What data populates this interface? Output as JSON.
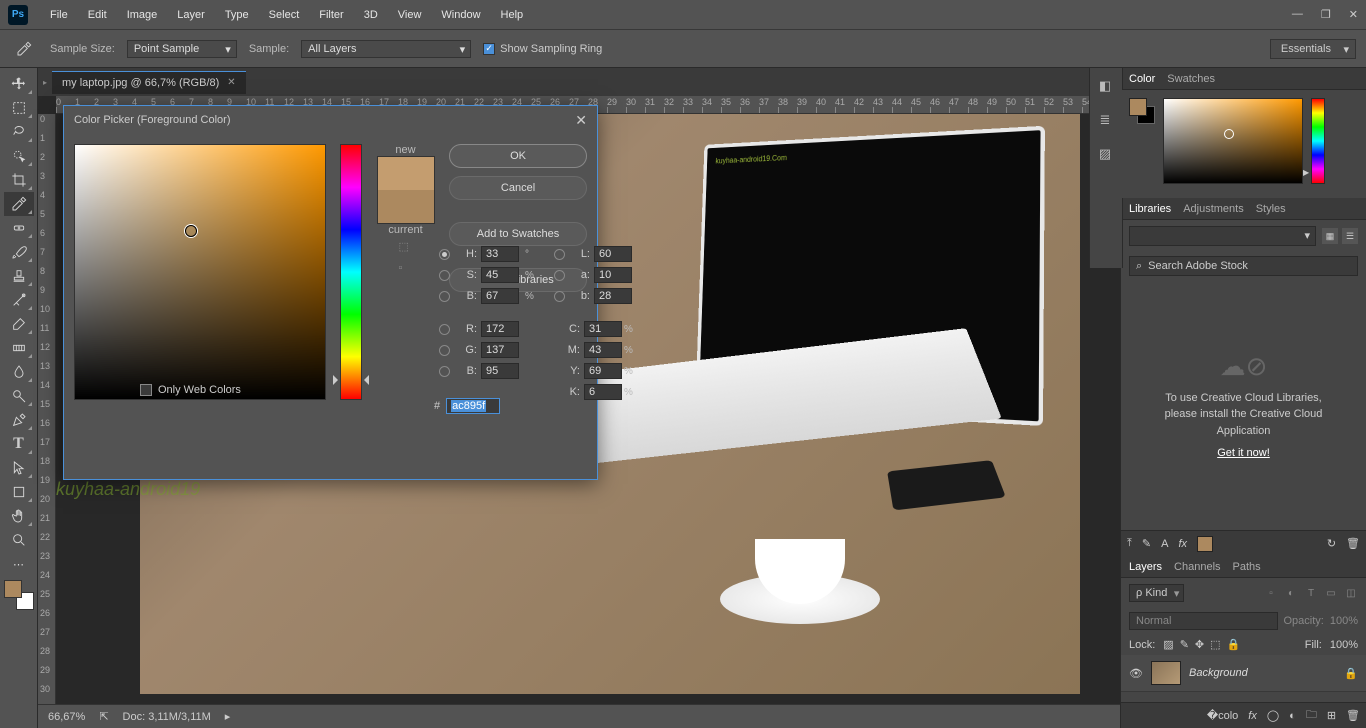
{
  "menu": {
    "file": "File",
    "edit": "Edit",
    "image": "Image",
    "layer": "Layer",
    "type": "Type",
    "select": "Select",
    "filter": "Filter",
    "three_d": "3D",
    "view": "View",
    "window": "Window",
    "help": "Help"
  },
  "options": {
    "sample_size_label": "Sample Size:",
    "sample_size_value": "Point Sample",
    "sample_label": "Sample:",
    "sample_value": "All Layers",
    "show_ring": "Show Sampling Ring",
    "workspace": "Essentials"
  },
  "doc": {
    "tab": "my laptop.jpg @ 66,7% (RGB/8)"
  },
  "watermark": "kuyhaa-android19",
  "status": {
    "zoom": "66,67%",
    "doc": "Doc: 3,11M/3,11M"
  },
  "picker": {
    "title": "Color Picker (Foreground Color)",
    "new": "new",
    "current": "current",
    "ok": "OK",
    "cancel": "Cancel",
    "add": "Add to Swatches",
    "libs": "Color Libraries",
    "only_web": "Only Web Colors",
    "h_lbl": "H:",
    "h": "33",
    "deg": "°",
    "s_lbl": "S:",
    "s": "45",
    "b_lbl": "B:",
    "b": "67",
    "r_lbl": "R:",
    "r": "172",
    "g_lbl": "G:",
    "g": "137",
    "bb_lbl": "B:",
    "bb": "95",
    "l_lbl": "L:",
    "l": "60",
    "a_lbl": "a:",
    "a": "10",
    "lab_b_lbl": "b:",
    "lab_b": "28",
    "c_lbl": "C:",
    "c": "31",
    "m_lbl": "M:",
    "m": "43",
    "y_lbl": "Y:",
    "y": "69",
    "k_lbl": "K:",
    "k": "6",
    "pct": "%",
    "hash": "#",
    "hex": "ac895f"
  },
  "panels": {
    "color": "Color",
    "swatches": "Swatches",
    "libraries": "Libraries",
    "adjustments": "Adjustments",
    "styles": "Styles",
    "search_ph": "Search Adobe Stock",
    "lib_msg1": "To use Creative Cloud Libraries,",
    "lib_msg2": "please install the Creative Cloud",
    "lib_msg3": "Application",
    "getit": "Get it now!",
    "layers": "Layers",
    "channels": "Channels",
    "paths": "Paths",
    "kind": "Kind",
    "normal": "Normal",
    "opacity_lbl": "Opacity:",
    "opacity": "100%",
    "lock": "Lock:",
    "fill_lbl": "Fill:",
    "fill": "100%",
    "bg_layer": "Background"
  },
  "screen_text": "kuyhaa-android19.Com"
}
